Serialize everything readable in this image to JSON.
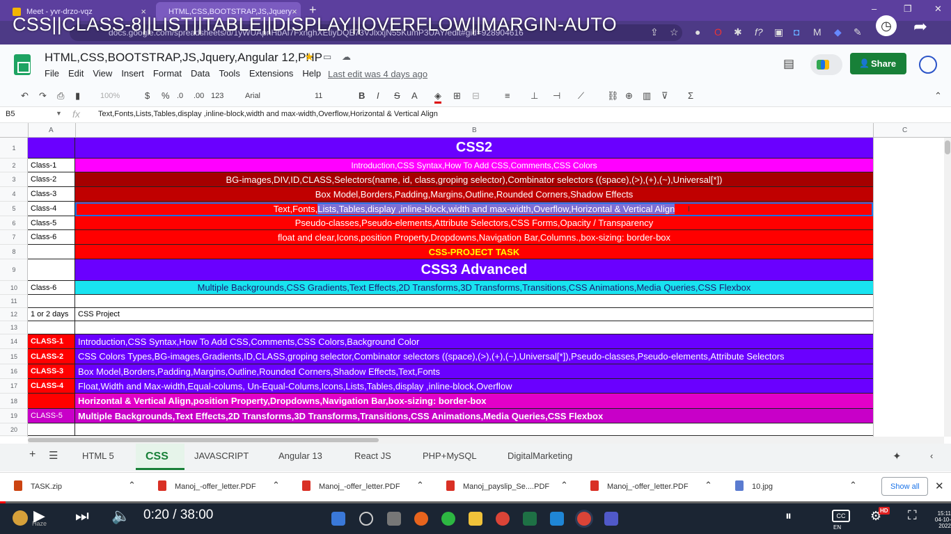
{
  "browser": {
    "tabs": [
      {
        "label": "Meet - yvr-drzo-vqz"
      },
      {
        "label": "HTML,CSS,BOOTSTRAP,JS,Jquery"
      }
    ],
    "close_glyph": "×",
    "new_tab_glyph": "+",
    "url": "docs.google.com/spreadsheets/d/1yWUApnHbAl7FxnghXEtiyDQE73VJlxxjN55KumP3UAY/edit#gid=928904616",
    "window_controls": [
      "–",
      "❐",
      "✕"
    ]
  },
  "video_title": "CSS||CLASS-8||LIST||TABLE||DISPLAY||OVERFLOW||MARGIN-AUTO",
  "sheets": {
    "doc_title": "HTML,CSS,BOOTSTRAP,JS,Jquery,Angular 12,PHP",
    "menu": [
      "File",
      "Edit",
      "View",
      "Insert",
      "Format",
      "Data",
      "Tools",
      "Extensions",
      "Help"
    ],
    "last_edit": "Last edit was 4 days ago",
    "share_label": "Share",
    "toolbar": {
      "zoom": "100%",
      "currency": "$",
      "percent": "%",
      "dec_decrease": ".0",
      "dec_increase": ".00",
      "format_123": "123",
      "font": "Arial",
      "font_size": "11",
      "bold": "B",
      "italic": "I",
      "strike": "S",
      "text_color": "A"
    },
    "name_box": "B5",
    "formula": "Text,Fonts,Lists,Tables,display ,inline-block,width and max-width,Overflow,Horizontal & Vertical Align",
    "columns": [
      "A",
      "B",
      "C"
    ],
    "rows": [
      {
        "n": "1",
        "a": "",
        "b": "CSS2",
        "bg": "#6a00ff",
        "color": "#ffffff",
        "abg": "#6a00ff",
        "h": 30,
        "big": true
      },
      {
        "n": "2",
        "a": "Class-1",
        "b": "Introduction,CSS Syntax,How To Add CSS,Comments,CSS Colors",
        "bg": "#ff00ff",
        "color": "#ffffff",
        "abg": "#ffffff",
        "h": 20
      },
      {
        "n": "3",
        "a": "Class-2",
        "b": "BG-images,DIV,ID,CLASS,Selectors(name, id, class,groping selector),Combinator selectors ((space),(>),(+),(~),Universal[*])",
        "bg": "#a50000",
        "color": "#ffffff",
        "abg": "#ffffff",
        "h": 21
      },
      {
        "n": "4",
        "a": "Class-3",
        "b": "Box Model,Borders,Padding,Margins,Outline,Rounded Corners,Shadow Effects",
        "bg": "#c00000",
        "color": "#ffffff",
        "abg": "#ffffff",
        "h": 21
      },
      {
        "n": "5",
        "a": "Class-4",
        "b": "Text,Fonts,Lists,Tables,display ,inline-block,width and max-width,Overflow,Horizontal & Vertical Align",
        "bg": "#ff0000",
        "color": "#ffffff",
        "abg": "#ffffff",
        "h": 21
      },
      {
        "n": "6",
        "a": "Class-5",
        "b": "Pseudo-classes,Pseudo-elements,Attribute Selectors,CSS Forms,Opacity / Transparency",
        "bg": "#ff0000",
        "color": "#ffffff",
        "abg": "#ffffff",
        "h": 20
      },
      {
        "n": "7",
        "a": "Class-6",
        "b": "float and clear,Icons,position Property,Dropdowns,Navigation Bar,Columns.,box-sizing: border-box",
        "bg": "#ff0000",
        "color": "#ffffff",
        "abg": "#ffffff",
        "h": 21
      },
      {
        "n": "8",
        "a": "",
        "b": "CSS-PROJECT TASK",
        "bg": "#ff0000",
        "color": "#ffff00",
        "abg": "#ffffff",
        "h": 21,
        "bold": true
      },
      {
        "n": "9",
        "a": "",
        "b": "CSS3 Advanced",
        "bg": "#6a00ff",
        "color": "#ffffff",
        "abg": "#ffffff",
        "h": 31,
        "big": true
      },
      {
        "n": "10",
        "a": "Class-6",
        "b": "Multiple Backgrounds,CSS Gradients,Text Effects,2D Transforms,3D Transforms,Transitions,CSS Animations,Media Queries,CSS Flexbox",
        "bg": "#19e3f0",
        "color": "#1b1b70",
        "abg": "#ffffff",
        "h": 20
      },
      {
        "n": "11",
        "a": "",
        "b": "",
        "bg": "#ffffff",
        "color": "#000000",
        "abg": "#ffffff",
        "h": 19
      },
      {
        "n": "12",
        "a": "1 or 2 days",
        "b": "CSS Project",
        "bg": "#ffffff",
        "color": "#000000",
        "abg": "#ffffff",
        "h": 19,
        "left": true,
        "small": true
      },
      {
        "n": "13",
        "a": "",
        "b": "",
        "bg": "#ffffff",
        "color": "#000000",
        "abg": "#ffffff",
        "h": 19
      },
      {
        "n": "14",
        "a": "CLASS-1",
        "b": "Introduction,CSS Syntax,How To Add CSS,Comments,CSS Colors,Background Color",
        "bg": "#6a00ff",
        "color": "#ffffff",
        "abg": "red",
        "h": 21,
        "left": true
      },
      {
        "n": "15",
        "a": "CLASS-2",
        "b": "CSS Colors Types,BG-images,Gradients,ID,CLASS,groping selector,Combinator selectors ((space),(>),(+),(~),Universal[*]),Pseudo-classes,Pseudo-elements,Attribute Selectors",
        "bg": "#6a00ff",
        "color": "#ffffff",
        "abg": "red",
        "h": 22,
        "left": true
      },
      {
        "n": "16",
        "a": "CLASS-3",
        "b": "Box Model,Borders,Padding,Margins,Outline,Rounded Corners,Shadow Effects,Text,Fonts",
        "bg": "#6a00ff",
        "color": "#ffffff",
        "abg": "red",
        "h": 21,
        "left": true
      },
      {
        "n": "17",
        "a": "CLASS-4",
        "b": "Float,Width and Max-width,Equal-colums, Un-Equal-Colums,Icons,Lists,Tables,display ,inline-block,Overflow",
        "bg": "#6a00ff",
        "color": "#ffffff",
        "abg": "red",
        "h": 21,
        "left": true
      },
      {
        "n": "18",
        "a": "",
        "b": "Horizontal & Vertical Align,position Property,Dropdowns,Navigation Bar,box-sizing: border-box",
        "bg": "#e300c8",
        "color": "#ffffff",
        "abg": "red",
        "h": 22,
        "left": true,
        "bold": true
      },
      {
        "n": "19",
        "a": "CLASS-5",
        "b": "Multiple Backgrounds,Text Effects,2D Transforms,3D Transforms,Transitions,CSS Animations,Media Queries,CSS Flexbox",
        "bg": "#c800c8",
        "color": "#ffffff",
        "abg": "#c800c8",
        "h": 21,
        "left": true,
        "bold": true
      },
      {
        "n": "20",
        "a": "",
        "b": "",
        "bg": "#ffffff",
        "color": "#000000",
        "abg": "#ffffff",
        "h": 18
      }
    ],
    "sheet_tabs": [
      "HTML 5",
      "CSS",
      "JAVASCRIPT",
      "Angular 13",
      "React JS",
      "PHP+MySQL",
      "DigitalMarketing"
    ]
  },
  "downloads": {
    "items": [
      "TASK.zip",
      "Manoj_-offer_letter.PDF",
      "Manoj_-offer_letter.PDF",
      "Manoj_payslip_Se....PDF",
      "Manoj_-offer_letter.PDF",
      "10.jpg"
    ],
    "show_all": "Show all"
  },
  "player": {
    "time": "0:20 / 38:00",
    "clock_time": "15:11",
    "clock_date": "04-10-2022",
    "weather": "Haze",
    "lang": "EN",
    "hd_badge": "HD"
  }
}
